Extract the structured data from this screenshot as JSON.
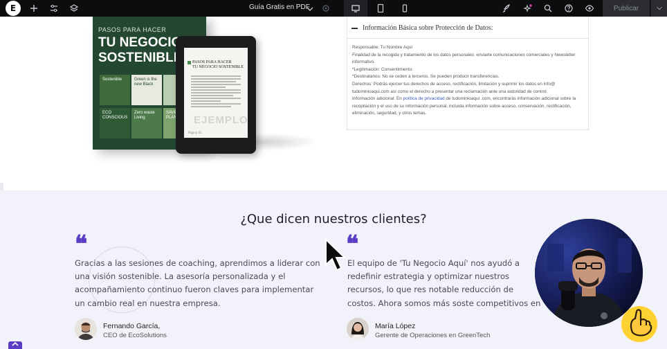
{
  "topbar": {
    "logo_letter": "E",
    "doc_title": "Guía Gratis en PDF",
    "publish_label": "Publicar",
    "icons": [
      "plus-icon",
      "sliders-icon",
      "layers-icon",
      "gear-icon",
      "desktop-icon",
      "tablet-icon",
      "mobile-icon",
      "rocket-icon",
      "ai-sparkle-icon",
      "search-icon",
      "help-icon",
      "eye-icon",
      "chevron-down-icon"
    ]
  },
  "book": {
    "small_title": "PASOS PARA HACER",
    "big_title_1": "TU NEGOCIO",
    "big_title_2": "SOSTENIBLE",
    "tiles": [
      "Sostenible",
      "Green is the new Black",
      "ECO CONSCIOUS",
      "Zero waste Living",
      "SAVE THE PLANET"
    ]
  },
  "ebook": {
    "title_1": "PASOS PARA HACER",
    "title_2": "TU NEGOCIO SOSTENIBLE",
    "watermark": "EJEMPLO",
    "page": "Página 01"
  },
  "privacy": {
    "title": "Información Básica sobre Protección de Datos:",
    "line1": "Responsable: Tu Nombre Aquí",
    "line2": "Finalidad de la recogida y tratamiento de los datos personales: enviarte comunicaciones comerciales y Newsletter informativo.",
    "line3": "*Legitimación: Consentimiento.",
    "line4": "*Destinatarios: No se ceden a terceros. Se pueden producir transferencias.",
    "line5": "Derechos: Podrás ejercer tus derechos de acceso, rectificación, limitación y suprimir los datos en info@ tudominioaqui.com así como el derecho a presentar una reclamación ante una autoridad de control.",
    "line6_a": "Información adicional: En ",
    "line6_link": "política de privacidad",
    "line6_b": " de tudominioaqui .com, encontrarás información adicional sobre la recopilación y el uso de su información personal, incluida información sobre acceso, conservación, rectificación, eliminación, seguridad, y otros temas."
  },
  "testimonials": {
    "heading": "¿Que dicen nuestros clientes?",
    "quote_glyph": "❝",
    "items": [
      {
        "text": "Gracias a las sesiones de coaching, aprendimos a liderar con una visión sostenible. La asesoría personalizada y el acompañamiento continuo fueron claves para implementar un cambio real en nuestra empresa.",
        "name": "Fernando García,",
        "role": "CEO de EcoSolutions"
      },
      {
        "text": "El equipo de 'Tu Negocio Aquí' nos ayudó a redefinir estrategia y optimizar nuestros recursos, lo que res notable reducción de costos. Ahora somos más soste competitivos en el mercado.",
        "name": "María López",
        "role": "Gerente de Operaciones en GreenTech"
      }
    ]
  },
  "colors": {
    "accent": "#5b3cc4",
    "topbar": "#0c0d0e",
    "section_bg": "#f2f2fb",
    "book_green": "#234730"
  }
}
